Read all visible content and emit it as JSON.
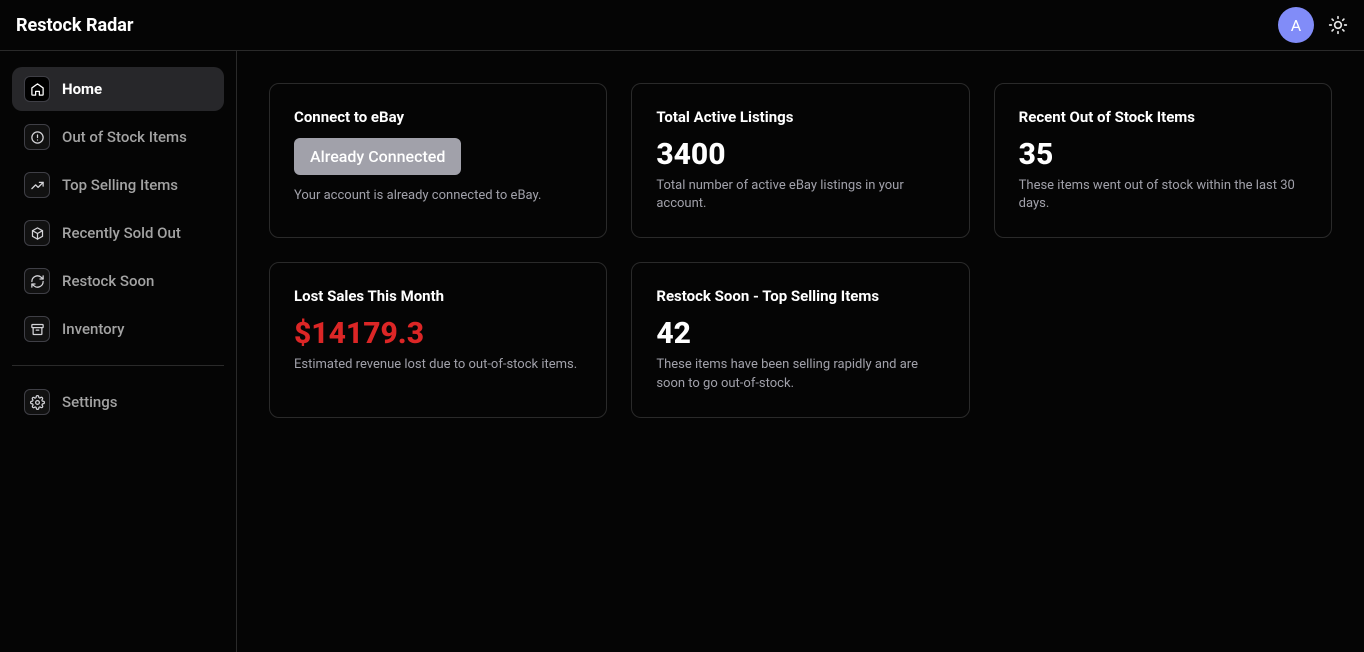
{
  "header": {
    "app_title": "Restock Radar",
    "avatar_initial": "A"
  },
  "sidebar": {
    "items": [
      {
        "label": "Home",
        "icon": "house-icon",
        "active": true
      },
      {
        "label": "Out of Stock Items",
        "icon": "alert-circle-icon",
        "active": false
      },
      {
        "label": "Top Selling Items",
        "icon": "trending-up-icon",
        "active": false
      },
      {
        "label": "Recently Sold Out",
        "icon": "package-icon",
        "active": false
      },
      {
        "label": "Restock Soon",
        "icon": "refresh-icon",
        "active": false
      },
      {
        "label": "Inventory",
        "icon": "archive-icon",
        "active": false
      }
    ],
    "settings_label": "Settings"
  },
  "cards": {
    "connect": {
      "title": "Connect to eBay",
      "button_label": "Already Connected",
      "desc": "Your account is already connected to eBay."
    },
    "active_listings": {
      "title": "Total Active Listings",
      "value": "3400",
      "desc": "Total number of active eBay listings in your account."
    },
    "recent_oos": {
      "title": "Recent Out of Stock Items",
      "value": "35",
      "desc": "These items went out of stock within the last 30 days."
    },
    "lost_sales": {
      "title": "Lost Sales This Month",
      "value": "$14179.3",
      "desc": "Estimated revenue lost due to out-of-stock items."
    },
    "restock_soon": {
      "title": "Restock Soon - Top Selling Items",
      "value": "42",
      "desc": "These items have been selling rapidly and are soon to go out-of-stock."
    }
  }
}
